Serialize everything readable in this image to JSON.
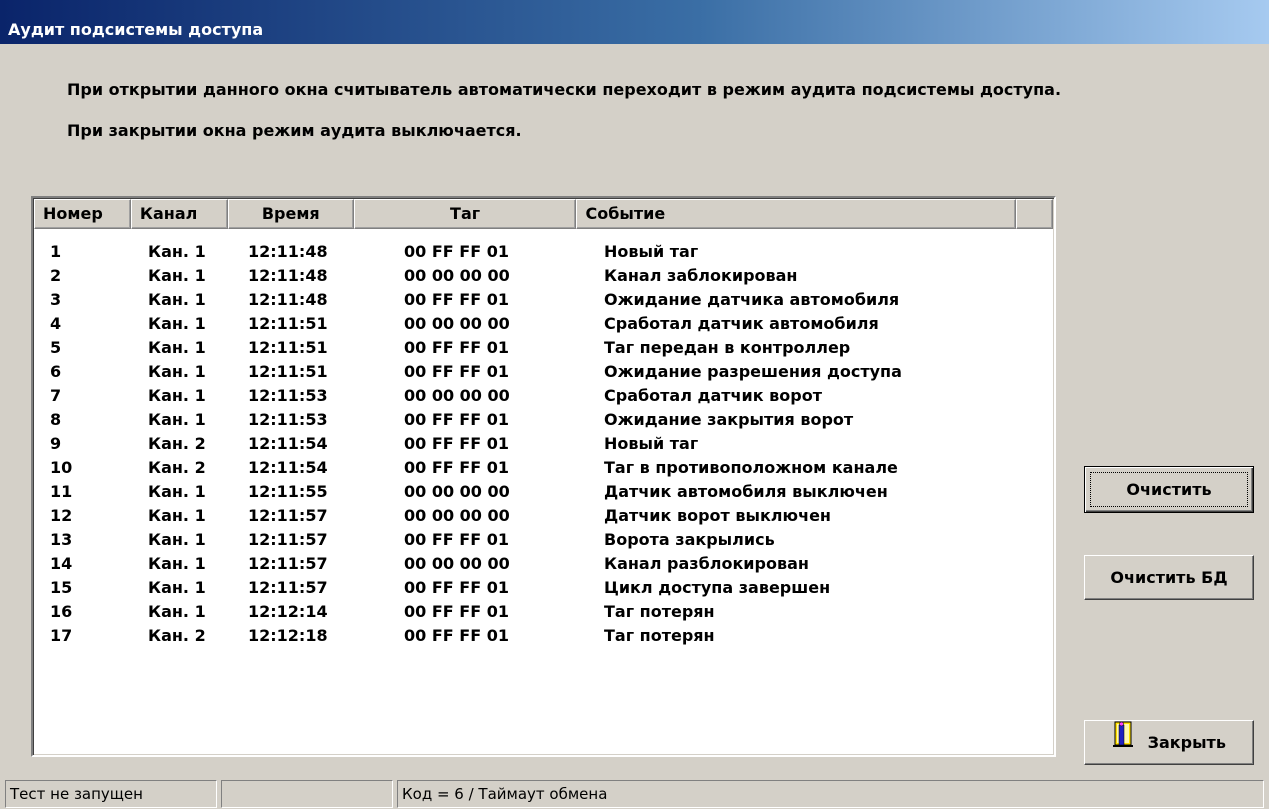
{
  "window": {
    "title": "Аудит подсистемы доступа"
  },
  "info": {
    "line1": "При открытии данного окна считыватель автоматически переходит в режим аудита подсистемы доступа.",
    "line2": "При закрытии окна режим аудита выключается."
  },
  "table": {
    "columns": [
      "Номер",
      "Канал",
      "Время",
      "Таг",
      "Событие"
    ],
    "rows": [
      [
        "1",
        "Кан. 1",
        "12:11:48",
        "00 FF FF 01",
        "Новый таг"
      ],
      [
        "2",
        "Кан. 1",
        "12:11:48",
        "00 00 00 00",
        "Канал заблокирован"
      ],
      [
        "3",
        "Кан. 1",
        "12:11:48",
        "00 FF FF 01",
        "Ожидание датчика автомобиля"
      ],
      [
        "4",
        "Кан. 1",
        "12:11:51",
        "00 00 00 00",
        "Сработал датчик автомобиля"
      ],
      [
        "5",
        "Кан. 1",
        "12:11:51",
        "00 FF FF 01",
        "Таг передан в контроллер"
      ],
      [
        "6",
        "Кан. 1",
        "12:11:51",
        "00 FF FF 01",
        "Ожидание разрешения доступа"
      ],
      [
        "7",
        "Кан. 1",
        "12:11:53",
        "00 00 00 00",
        "Сработал датчик ворот"
      ],
      [
        "8",
        "Кан. 1",
        "12:11:53",
        "00 FF FF 01",
        "Ожидание закрытия ворот"
      ],
      [
        "9",
        "Кан. 2",
        "12:11:54",
        "00 FF FF 01",
        "Новый таг"
      ],
      [
        "10",
        "Кан. 2",
        "12:11:54",
        "00 FF FF 01",
        "Таг в противоположном канале"
      ],
      [
        "11",
        "Кан. 1",
        "12:11:55",
        "00 00 00 00",
        "Датчик автомобиля выключен"
      ],
      [
        "12",
        "Кан. 1",
        "12:11:57",
        "00 00 00 00",
        "Датчик ворот выключен"
      ],
      [
        "13",
        "Кан. 1",
        "12:11:57",
        "00 FF FF 01",
        "Ворота закрылись"
      ],
      [
        "14",
        "Кан. 1",
        "12:11:57",
        "00 00 00 00",
        "Канал разблокирован"
      ],
      [
        "15",
        "Кан. 1",
        "12:11:57",
        "00 FF FF 01",
        "Цикл доступа завершен"
      ],
      [
        "16",
        "Кан. 1",
        "12:12:14",
        "00 FF FF 01",
        "Таг потерян"
      ],
      [
        "17",
        "Кан. 2",
        "12:12:18",
        "00 FF FF 01",
        "Таг потерян"
      ]
    ]
  },
  "buttons": {
    "clear": "Очистить",
    "clear_db": "Очистить БД",
    "close": "Закрыть",
    "close_icon": "door-exit-icon"
  },
  "statusbar": {
    "panel1": "Тест не запущен",
    "panel2": "",
    "panel3": "Код = 6 / Таймаут обмена"
  }
}
